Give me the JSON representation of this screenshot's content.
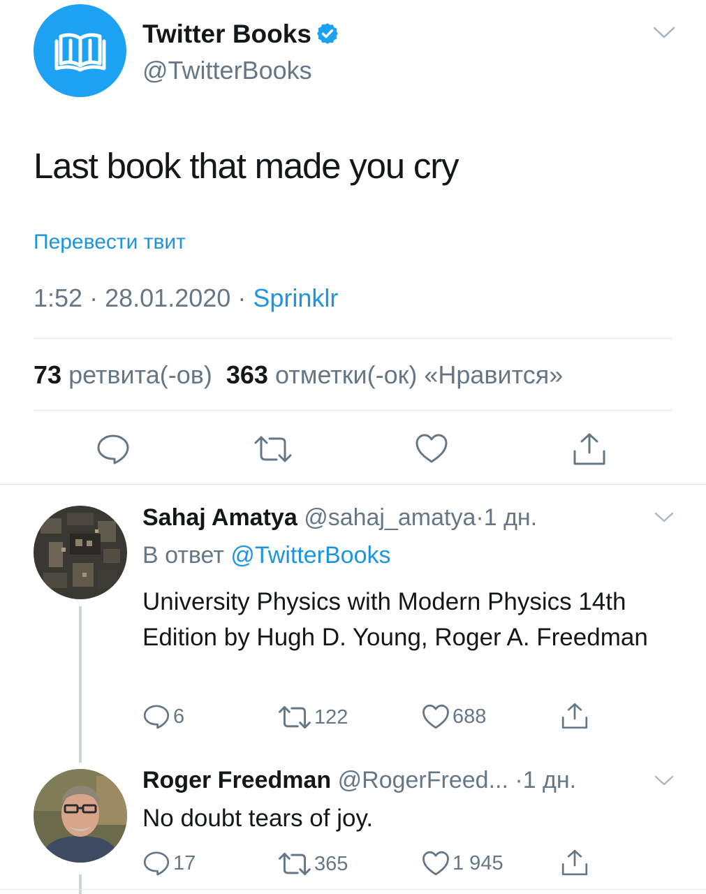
{
  "tweet": {
    "author_name": "Twitter Books",
    "author_handle": "@TwitterBooks",
    "text": "Last book that made you cry",
    "translate_label": "Перевести твит",
    "time": "1:52",
    "sep": "·",
    "date": "28.01.2020",
    "source": "Sprinklr",
    "retweets_count": "73",
    "retweets_label": "ретвита(-ов)",
    "likes_count": "363",
    "likes_label": "отметки(-ок) «Нравится»"
  },
  "replies": [
    {
      "name": "Sahaj Amatya",
      "handle": "@sahaj_amatya",
      "time": "1 дн.",
      "reply_to_prefix": "В ответ",
      "reply_to_handle": "@TwitterBooks",
      "text": "University Physics with Modern Physics 14th Edition by Hugh D. Young, Roger A. Freedman",
      "reply_count": "6",
      "retweet_count": "122",
      "like_count": "688"
    },
    {
      "name": "Roger Freedman",
      "handle": "@RogerFreed...",
      "time": "1 дн.",
      "text": "No doubt tears of joy.",
      "reply_count": "17",
      "retweet_count": "365",
      "like_count": "1 945"
    }
  ],
  "icons": {
    "avatar": "open-book-icon",
    "verified": "verified-badge-icon",
    "menu": "chevron-down-icon",
    "reply": "reply-icon",
    "retweet": "retweet-icon",
    "like": "heart-icon",
    "share": "share-icon"
  },
  "colors": {
    "accent": "#1da1f2",
    "link": "#1b95e0",
    "muted": "#657786",
    "divider": "#e1e8ed",
    "thread_line": "#ccd6dd"
  }
}
